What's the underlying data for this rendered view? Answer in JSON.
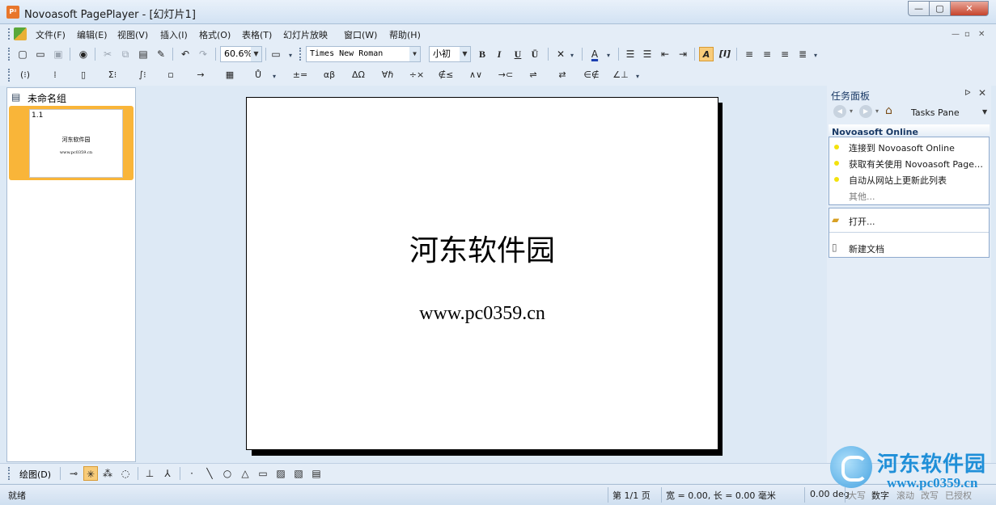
{
  "window": {
    "app_icon": "P²",
    "title": "Novoasoft PagePlayer - [幻灯片1]",
    "min": "—",
    "max": "▢",
    "close": "✕"
  },
  "menu": {
    "items": [
      "文件(F)",
      "编辑(E)",
      "视图(V)",
      "插入(I)",
      "格式(O)",
      "表格(T)",
      "幻灯片放映",
      "窗口(W)",
      "帮助(H)"
    ],
    "mdi_min": "—",
    "mdi_restore": "▫",
    "mdi_close": "✕"
  },
  "toolbar": {
    "zoom": "60.6%",
    "font_name": "Times New Roman",
    "font_size": "小初",
    "bold": "B",
    "italic": "I",
    "underline": "U",
    "overline": "Ū",
    "math_a": "A",
    "math_i": "[I]"
  },
  "toolbar2": {
    "symbols": [
      "(⁝)",
      "⁞",
      "▯",
      "Σ⁝",
      "∫⁝",
      "▫",
      "→",
      "▦",
      "Ů",
      "±=",
      "αβ",
      "ΔΩ",
      "∀ℏ",
      "÷×",
      "∉≤",
      "∧∨",
      "→⊂",
      "⇌",
      "⇄",
      "∈∉",
      "∠⊥"
    ]
  },
  "left_panel": {
    "group_label": "未命名组",
    "thumb_number": "1.1",
    "thumb_title": "河东软件园",
    "thumb_sub": "www.pc0359.cn"
  },
  "slide": {
    "title": "河东软件园",
    "subtitle": "www.pc0359.cn"
  },
  "task_pane": {
    "title": "任务面板",
    "pin": "ᐅ",
    "close": "✕",
    "nav_label": "Tasks Pane",
    "section_title": "Novoasoft Online",
    "links": [
      "连接到 Novoasoft Online",
      "获取有关使用 Novoasoft PagePlayer",
      "自动从网站上更新此列表"
    ],
    "more": "其他...",
    "open": "打开...",
    "new_doc": "新建文档"
  },
  "drawbar": {
    "label": "绘图(D)"
  },
  "status": {
    "ready": "就绪",
    "page": "第 1/1 页",
    "width": "宽 =  0.00, 长 =  0.00 毫米",
    "angle": "0.00 deg",
    "caps": "大写",
    "num": "数字",
    "scroll": "滚动",
    "overwrite": "改写",
    "override": "已授权"
  },
  "watermark": {
    "text": "河东软件园",
    "url": "www.pc0359.cn"
  },
  "colors": {
    "accent": "#f9b539",
    "background": "#dde9f5",
    "close_button": "#c6432b"
  }
}
